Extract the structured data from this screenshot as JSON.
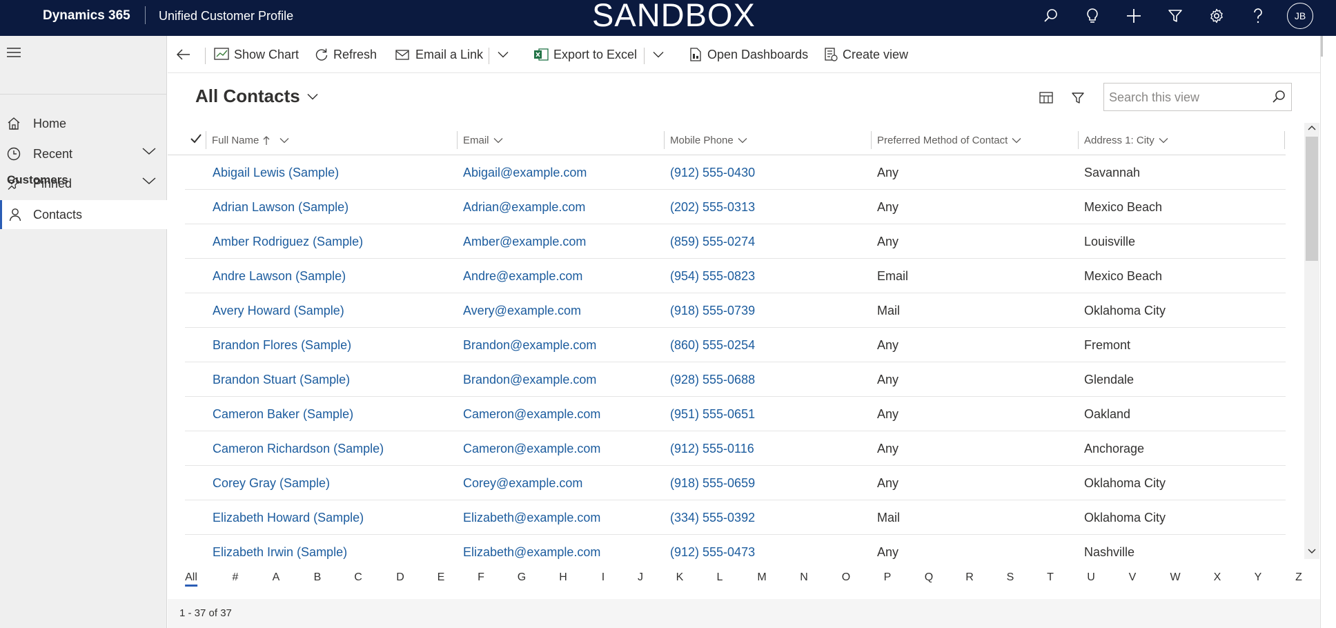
{
  "topbar": {
    "brand": "Dynamics 365",
    "app_name": "Unified Customer Profile",
    "environment": "SANDBOX",
    "icons": [
      "search-icon",
      "lightbulb-icon",
      "plus-icon",
      "filter-icon",
      "gear-icon",
      "help-icon"
    ],
    "user_initials": "JB",
    "background_color": "#0b1a3f"
  },
  "sidebar": {
    "items": [
      {
        "label": "Home",
        "icon": "home-icon"
      },
      {
        "label": "Recent",
        "icon": "clock-icon"
      },
      {
        "label": "Pinned",
        "icon": "pin-icon"
      }
    ],
    "section_header": "Customers",
    "section_items": [
      {
        "label": "Contacts",
        "icon": "person-icon",
        "active": true
      }
    ]
  },
  "commandbar": {
    "show_chart": "Show Chart",
    "refresh": "Refresh",
    "email_link": "Email a Link",
    "export_excel": "Export to Excel",
    "open_dashboards": "Open Dashboards",
    "create_view": "Create view"
  },
  "view": {
    "title": "All Contacts",
    "search_placeholder": "Search this view"
  },
  "grid": {
    "columns": [
      "Full Name",
      "Email",
      "Mobile Phone",
      "Preferred Method of Contact",
      "Address 1: City"
    ],
    "sorted_column": "Full Name",
    "sort_direction": "ascending",
    "rows": [
      [
        "Abigail Lewis (Sample)",
        "Abigail@example.com",
        "(912) 555-0430",
        "Any",
        "Savannah"
      ],
      [
        "Adrian Lawson (Sample)",
        "Adrian@example.com",
        "(202) 555-0313",
        "Any",
        "Mexico Beach"
      ],
      [
        "Amber Rodriguez (Sample)",
        "Amber@example.com",
        "(859) 555-0274",
        "Any",
        "Louisville"
      ],
      [
        "Andre Lawson (Sample)",
        "Andre@example.com",
        "(954) 555-0823",
        "Email",
        "Mexico Beach"
      ],
      [
        "Avery Howard (Sample)",
        "Avery@example.com",
        "(918) 555-0739",
        "Mail",
        "Oklahoma City"
      ],
      [
        "Brandon Flores (Sample)",
        "Brandon@example.com",
        "(860) 555-0254",
        "Any",
        "Fremont"
      ],
      [
        "Brandon Stuart (Sample)",
        "Brandon@example.com",
        "(928) 555-0688",
        "Any",
        "Glendale"
      ],
      [
        "Cameron Baker (Sample)",
        "Cameron@example.com",
        "(951) 555-0651",
        "Any",
        "Oakland"
      ],
      [
        "Cameron Richardson (Sample)",
        "Cameron@example.com",
        "(912) 555-0116",
        "Any",
        "Anchorage"
      ],
      [
        "Corey Gray (Sample)",
        "Corey@example.com",
        "(918) 555-0659",
        "Any",
        "Oklahoma City"
      ],
      [
        "Elizabeth Howard (Sample)",
        "Elizabeth@example.com",
        "(334) 555-0392",
        "Mail",
        "Oklahoma City"
      ],
      [
        "Elizabeth Irwin (Sample)",
        "Elizabeth@example.com",
        "(912) 555-0473",
        "Any",
        "Nashville"
      ]
    ]
  },
  "alphabet": {
    "letters": [
      "All",
      "#",
      "A",
      "B",
      "C",
      "D",
      "E",
      "F",
      "G",
      "H",
      "I",
      "J",
      "K",
      "L",
      "M",
      "N",
      "O",
      "P",
      "Q",
      "R",
      "S",
      "T",
      "U",
      "V",
      "W",
      "X",
      "Y",
      "Z"
    ],
    "selected": "All"
  },
  "footer": {
    "record_count": "1 - 37 of 37"
  },
  "colors": {
    "accent": "#2b5db5",
    "link": "#1c5c9e"
  }
}
